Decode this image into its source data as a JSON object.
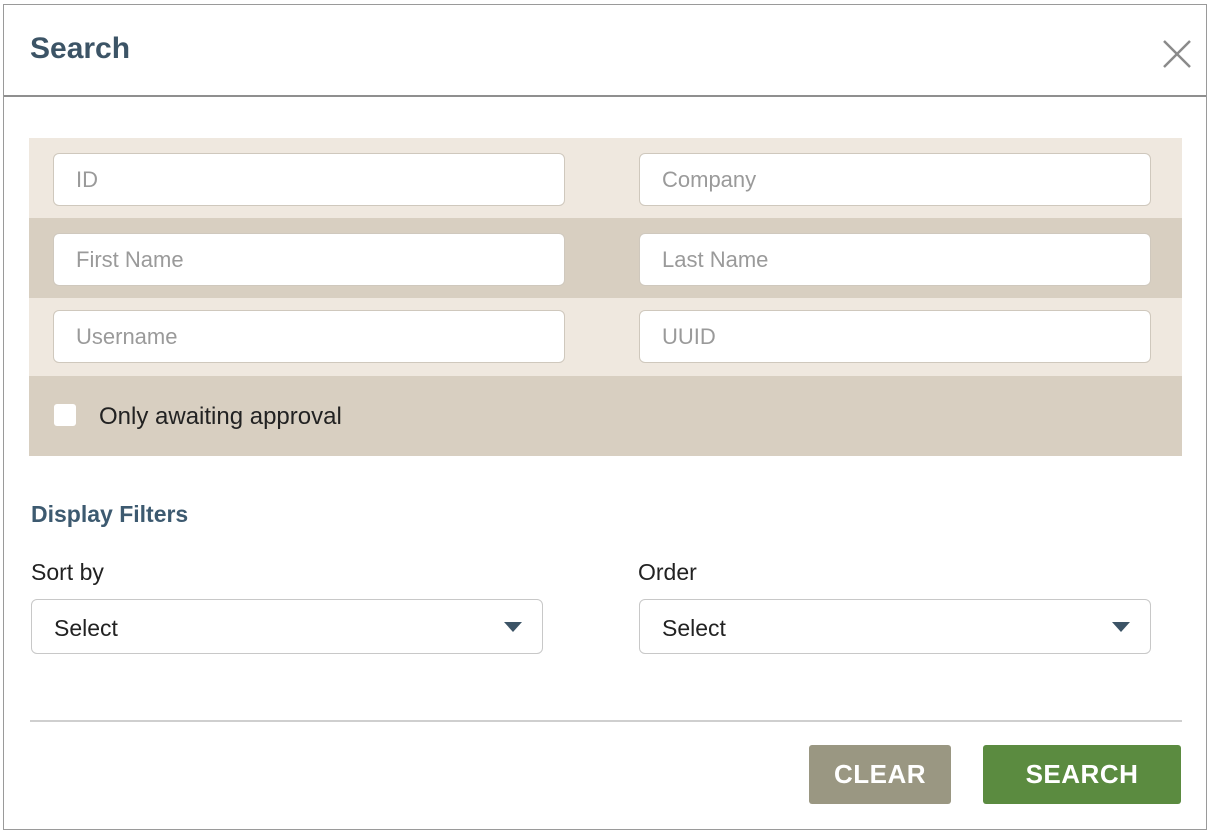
{
  "modal": {
    "title": "Search",
    "close_icon": "close-icon"
  },
  "filters": {
    "id_placeholder": "ID",
    "company_placeholder": "Company",
    "first_name_placeholder": "First Name",
    "last_name_placeholder": "Last Name",
    "username_placeholder": "Username",
    "uuid_placeholder": "UUID",
    "awaiting_approval_label": "Only awaiting approval",
    "awaiting_approval_checked": false
  },
  "display_filters": {
    "title": "Display Filters",
    "sort_by_label": "Sort by",
    "sort_by_value": "Select",
    "order_label": "Order",
    "order_value": "Select"
  },
  "actions": {
    "clear_label": "CLEAR",
    "search_label": "SEARCH"
  },
  "colors": {
    "title": "#3c5466",
    "row_light": "#efe8df",
    "row_dark": "#d8cfc1",
    "clear_button": "#9a9782",
    "search_button": "#5b8b40"
  }
}
